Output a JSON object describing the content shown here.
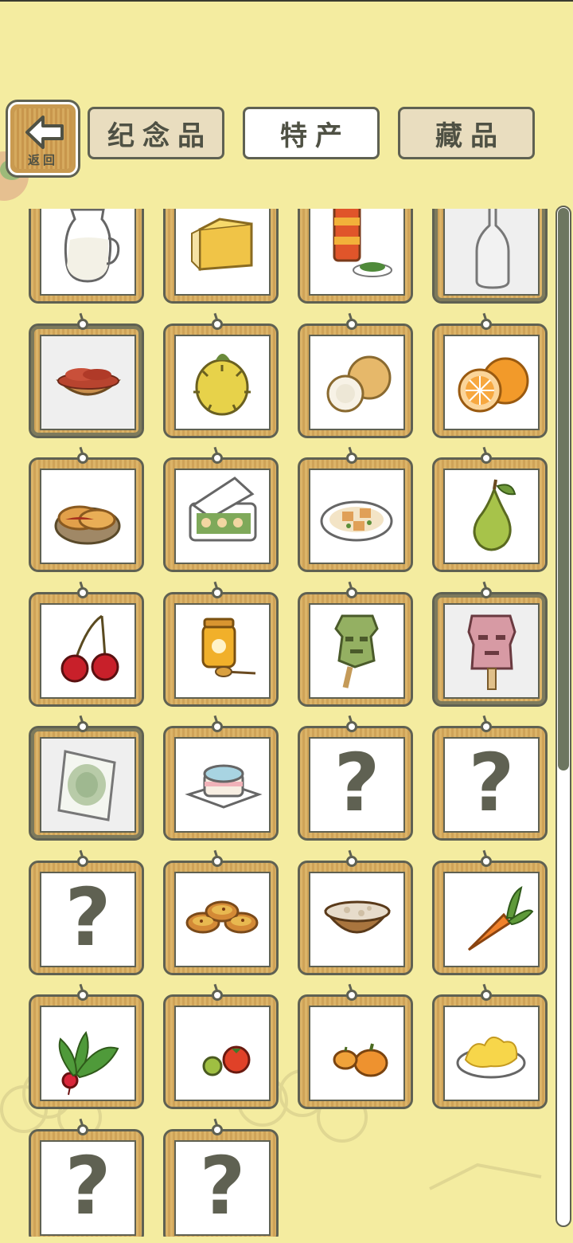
{
  "header": {
    "back_label": "返回",
    "tabs": [
      {
        "label": "纪念品",
        "active": false
      },
      {
        "label": "特产",
        "active": true
      },
      {
        "label": "藏品",
        "active": false
      }
    ]
  },
  "grid": {
    "items": [
      {
        "icon": "milk-pitcher-icon",
        "unknown": false,
        "selected": false
      },
      {
        "icon": "cheese-icon",
        "unknown": false,
        "selected": false
      },
      {
        "icon": "tea-canister-icon",
        "unknown": false,
        "selected": false
      },
      {
        "icon": "glass-bottle-icon",
        "unknown": false,
        "selected": true
      },
      {
        "icon": "goji-berries-bowl-icon",
        "unknown": false,
        "selected": true
      },
      {
        "icon": "durian-fruit-icon",
        "unknown": false,
        "selected": false
      },
      {
        "icon": "melon-icon",
        "unknown": false,
        "selected": false
      },
      {
        "icon": "orange-icon",
        "unknown": false,
        "selected": false
      },
      {
        "icon": "pastry-plate-icon",
        "unknown": false,
        "selected": false
      },
      {
        "icon": "bento-box-icon",
        "unknown": false,
        "selected": false
      },
      {
        "icon": "tofu-dish-icon",
        "unknown": false,
        "selected": false
      },
      {
        "icon": "pear-icon",
        "unknown": false,
        "selected": false
      },
      {
        "icon": "cherries-icon",
        "unknown": false,
        "selected": false
      },
      {
        "icon": "honey-jar-icon",
        "unknown": false,
        "selected": false
      },
      {
        "icon": "bronze-mask-popsicle-icon",
        "unknown": false,
        "selected": false
      },
      {
        "icon": "pink-mask-popsicle-icon",
        "unknown": false,
        "selected": true
      },
      {
        "icon": "snack-bag-icon",
        "unknown": false,
        "selected": true
      },
      {
        "icon": "cake-icon",
        "unknown": false,
        "selected": false
      },
      {
        "icon": "question-mark-icon",
        "unknown": true,
        "selected": false,
        "glyph": "?"
      },
      {
        "icon": "question-mark-icon",
        "unknown": true,
        "selected": false,
        "glyph": "?"
      },
      {
        "icon": "question-mark-icon",
        "unknown": true,
        "selected": false,
        "glyph": "?"
      },
      {
        "icon": "egg-tarts-icon",
        "unknown": false,
        "selected": false
      },
      {
        "icon": "porridge-bowl-icon",
        "unknown": false,
        "selected": false
      },
      {
        "icon": "carrot-icon",
        "unknown": false,
        "selected": false
      },
      {
        "icon": "radish-icon",
        "unknown": false,
        "selected": false
      },
      {
        "icon": "tomatoes-icon",
        "unknown": false,
        "selected": false
      },
      {
        "icon": "pumpkins-icon",
        "unknown": false,
        "selected": false
      },
      {
        "icon": "scrambled-eggs-icon",
        "unknown": false,
        "selected": false
      },
      {
        "icon": "question-mark-icon",
        "unknown": true,
        "selected": false,
        "glyph": "?"
      },
      {
        "icon": "question-mark-icon",
        "unknown": true,
        "selected": false,
        "glyph": "?"
      }
    ]
  },
  "scrollbar": {
    "position_fraction": 0.0
  }
}
